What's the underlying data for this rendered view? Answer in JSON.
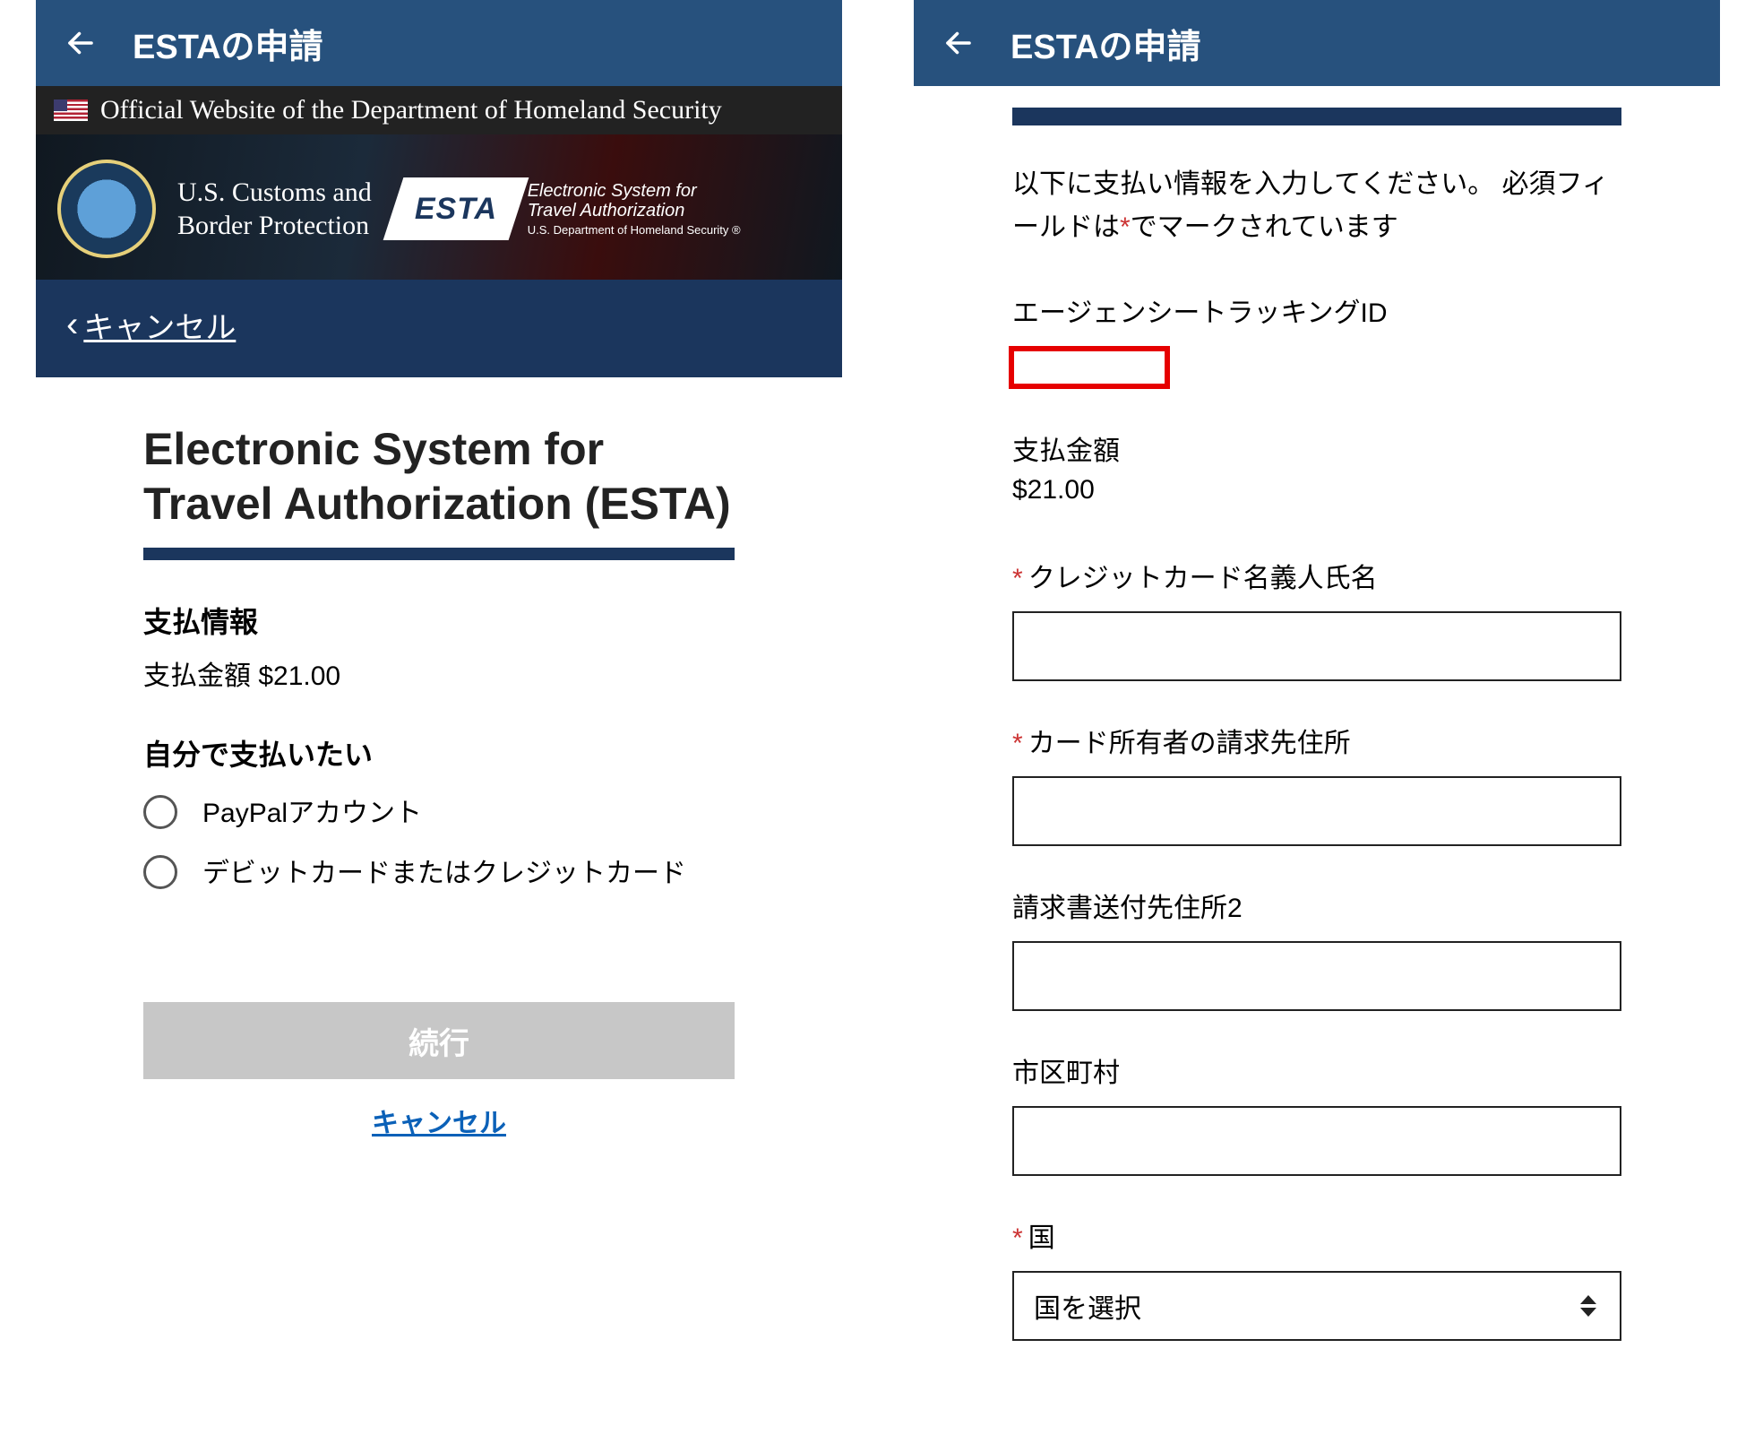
{
  "appbar": {
    "title": "ESTAの申請"
  },
  "left": {
    "dhs_strip": "Official Website of the Department of Homeland Security",
    "cbp_line1": "U.S. Customs and",
    "cbp_line2": "Border Protection",
    "esta_logo_text": "ESTA",
    "esta_sub_line1": "Electronic System for",
    "esta_sub_line2": "Travel Authorization",
    "esta_sub_dept": "U.S. Department of Homeland Security ®",
    "cancel_bar": "キャンセル",
    "page_title": "Electronic System for Travel Authorization (ESTA)",
    "section_payinfo": "支払情報",
    "amount_label": "支払金額",
    "amount_value": "$21.00",
    "section_paywith": "自分で支払いたい",
    "radio1": "PayPalアカウント",
    "radio2": "デビットカードまたはクレジットカード",
    "continue_btn": "続行",
    "cancel_link": "キャンセル"
  },
  "right": {
    "instruction_a": "以下に支払い情報を入力してください。 必須フィールドは",
    "instruction_star": "*",
    "instruction_b": "でマークされています",
    "tracking_label": "エージェンシートラッキングID",
    "amount_label": "支払金額",
    "amount_value": "$21.00",
    "cardholder_label": "クレジットカード名義人氏名",
    "billing1_label": "カード所有者の請求先住所",
    "billing2_label": "請求書送付先住所2",
    "city_label": "市区町村",
    "country_label": "国",
    "country_placeholder": "国を選択"
  }
}
